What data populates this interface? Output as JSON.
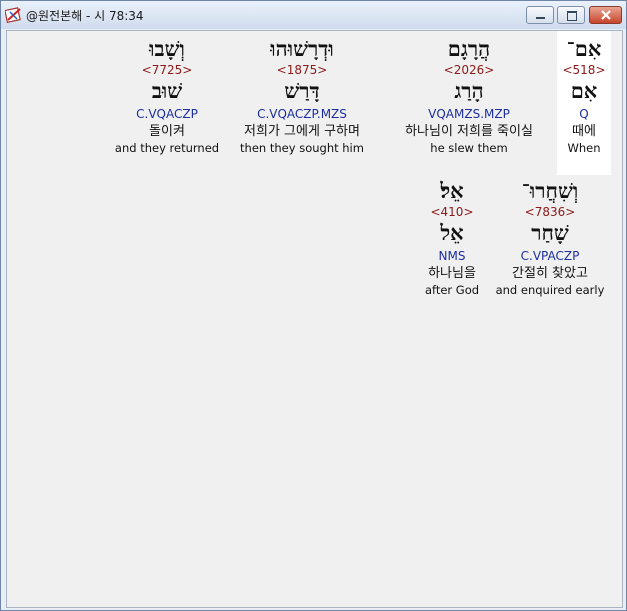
{
  "window": {
    "title": "@원전본해 - 시 78:34",
    "icons": {
      "app": "bible-tool-icon",
      "minimize": "minimize-icon",
      "maximize": "maximize-icon",
      "close": "close-icon"
    },
    "colors": {
      "close_button": "#c7452c",
      "selected_word_bg": "#ffffff",
      "strong_number": "#8b1a1a",
      "parsing": "#1c2ea0"
    }
  },
  "words": [
    {
      "hebrew": "אִם־",
      "strong": "<518>",
      "lemma": "אִם",
      "parsing": "Q",
      "korean": "때에",
      "english": "When"
    },
    {
      "hebrew": "הֲרָגָם",
      "strong": "<2026>",
      "lemma": "הָרַג",
      "parsing": "VQAMZS.MZP",
      "korean": "하나님이 저희를 죽이실",
      "english": "he slew them"
    },
    {
      "hebrew": "וּדְרָשׁוּהוּ",
      "strong": "<1875>",
      "lemma": "דָּרַשׁ",
      "parsing": "C.VQACZP.MZS",
      "korean": "저희가 그에게 구하며",
      "english": "then they sought him"
    },
    {
      "hebrew": "וְשָׁבוּ",
      "strong": "<7725>",
      "lemma": "שׁוּב",
      "parsing": "C.VQACZP",
      "korean": "돌이켜",
      "english": "and they returned"
    },
    {
      "hebrew": "וְשִׁחֲרוּ־",
      "strong": "<7836>",
      "lemma": "שָׁחַר",
      "parsing": "C.VPACZP",
      "korean": "간절히 찾았고",
      "english": "and enquired early"
    },
    {
      "hebrew": "אֵל׃",
      "strong": "<410>",
      "lemma": "אֵל",
      "parsing": "NMS",
      "korean": "하나님을",
      "english": "after God"
    }
  ]
}
